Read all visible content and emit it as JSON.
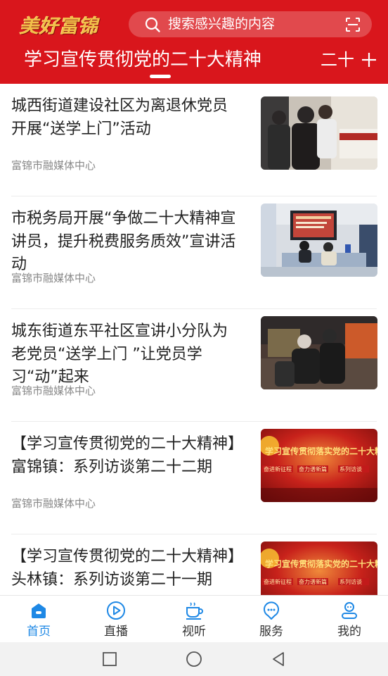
{
  "header": {
    "logo_text": "美好富锦",
    "search_placeholder": "搜索感兴趣的内容",
    "channels": [
      "学习宣传贯彻党的二十大精神",
      "二十"
    ],
    "colors": {
      "brand_red": "#d9161c",
      "logo_gold": "#f2c04a"
    },
    "icons": [
      "search-icon",
      "scan-icon",
      "plus-icon"
    ]
  },
  "news": [
    {
      "title": "城西街道建设社区为离退休党员开展“送学上门”活动",
      "source": "富锦市融媒体中心"
    },
    {
      "title": "市税务局开展“争做二十大精神宣讲员，提升税费服务质效”宣讲活动",
      "source": "富锦市融媒体中心"
    },
    {
      "title": "城东街道东平社区宣讲小分队为老党员“送学上门 ”让党员学习“动”起来",
      "source": "富锦市融媒体中心"
    },
    {
      "title": "【学习宣传贯彻党的二十大精神】富锦镇：系列访谈第二十二期",
      "source": "富锦市融媒体中心"
    },
    {
      "title": "【学习宣传贯彻党的二十大精神】头林镇：系列访谈第二十一期",
      "source": ""
    }
  ],
  "thumb_text": {
    "banner": "学习宣传贯彻落实党的二十大精神",
    "chips": [
      "奋进新征程",
      "奋力谱新篇",
      "系列访谈"
    ]
  },
  "tabs": [
    {
      "label": "首页",
      "icon": "home-icon",
      "active": true
    },
    {
      "label": "直播",
      "icon": "play-circle-icon",
      "active": false
    },
    {
      "label": "视听",
      "icon": "cup-icon",
      "active": false
    },
    {
      "label": "服务",
      "icon": "location-chat-icon",
      "active": false
    },
    {
      "label": "我的",
      "icon": "user-icon",
      "active": false
    }
  ],
  "tab_colors": {
    "active": "#1e88e5",
    "inactive": "#333333"
  },
  "system_nav": [
    "recents-button",
    "home-button",
    "back-button"
  ]
}
